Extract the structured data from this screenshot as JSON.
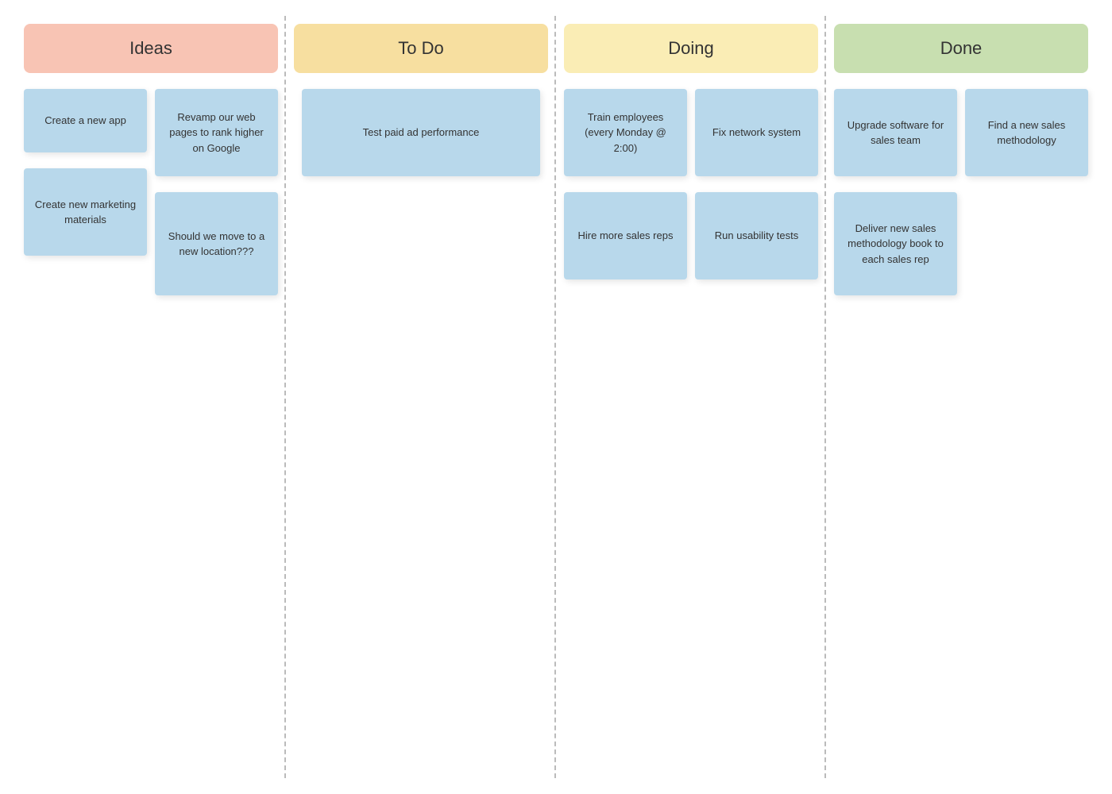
{
  "columns": [
    {
      "id": "ideas",
      "label": "Ideas",
      "headerClass": "header-ideas",
      "cards_left": [
        {
          "text": "Create a new app",
          "size": "sticky-sm"
        },
        {
          "text": "Create new marketing materials",
          "size": "sticky-md"
        }
      ],
      "cards_right": [
        {
          "text": "Revamp our web pages to rank higher on Google",
          "size": "sticky-md"
        },
        {
          "text": "Should we move to a new location???",
          "size": "sticky-lg"
        }
      ]
    },
    {
      "id": "todo",
      "label": "To Do",
      "headerClass": "header-todo",
      "cards": [
        {
          "text": "Test paid ad performance",
          "size": "sticky-md"
        }
      ]
    },
    {
      "id": "doing",
      "label": "Doing",
      "headerClass": "header-doing",
      "cards_left": [
        {
          "text": "Train employees (every Monday @ 2:00)",
          "size": "sticky-md"
        },
        {
          "text": "Hire more sales reps",
          "size": "sticky-md"
        }
      ],
      "cards_right": [
        {
          "text": "Fix network system",
          "size": "sticky-md"
        },
        {
          "text": "Run usability tests",
          "size": "sticky-md"
        }
      ]
    },
    {
      "id": "done",
      "label": "Done",
      "headerClass": "header-done",
      "cards_left": [
        {
          "text": "Upgrade software for sales team",
          "size": "sticky-md"
        },
        {
          "text": "Deliver new sales methodology book to each sales rep",
          "size": "sticky-lg"
        }
      ],
      "cards_right": [
        {
          "text": "Find a new sales methodology",
          "size": "sticky-md"
        }
      ]
    }
  ]
}
